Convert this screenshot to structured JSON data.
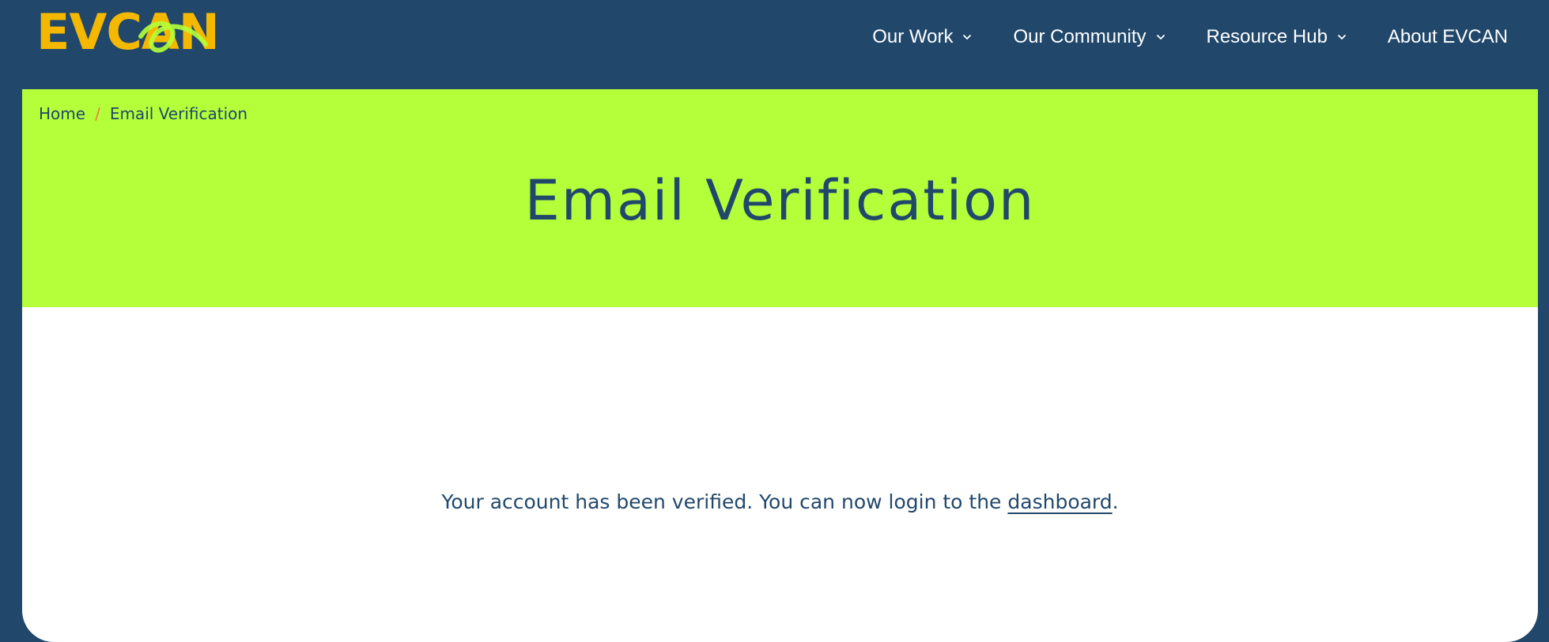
{
  "header": {
    "logo_text": "EVCAN",
    "nav": [
      {
        "label": "Our Work",
        "has_dropdown": true,
        "icon": "chevron-down-icon"
      },
      {
        "label": "Our Community",
        "has_dropdown": true,
        "icon": "chevron-down-icon"
      },
      {
        "label": "Resource Hub",
        "has_dropdown": true,
        "icon": "chevron-down-icon"
      },
      {
        "label": "About EVCAN",
        "has_dropdown": false
      }
    ]
  },
  "breadcrumb": {
    "home": "Home",
    "separator": "/",
    "current": "Email Verification"
  },
  "page": {
    "title": "Email Verification",
    "message_before": "Your account has been verified. You can now login to the ",
    "message_link": "dashboard",
    "message_after": "."
  },
  "colors": {
    "header_bg": "#21486b",
    "hero_bg": "#b4ff3a",
    "logo": "#f5b800",
    "text": "#21486b",
    "breadcrumb_separator": "#f07b3c"
  }
}
